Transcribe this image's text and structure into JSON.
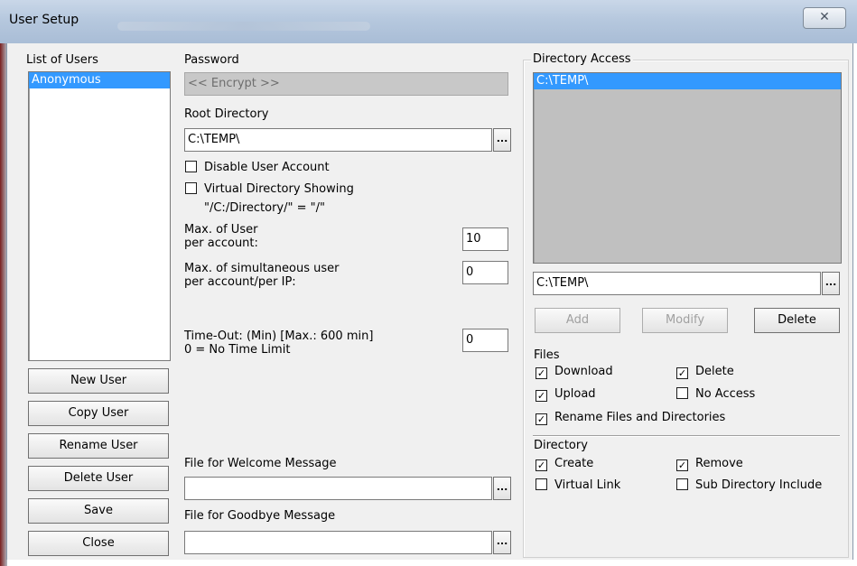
{
  "window": {
    "title": "User Setup",
    "close_glyph": "✕"
  },
  "users": {
    "label": "List of Users",
    "items": [
      "Anonymous"
    ],
    "buttons": [
      "New User",
      "Copy User",
      "Rename User",
      "Delete User",
      "Save",
      "Close"
    ]
  },
  "password": {
    "label": "Password",
    "value": "<< Encrypt >>"
  },
  "root_dir": {
    "label": "Root Directory",
    "value": "C:\\TEMP\\",
    "browse": "..."
  },
  "options": {
    "disable_account": {
      "label": "Disable User Account",
      "checked": false
    },
    "virtual_dir": {
      "label": "Virtual Directory Showing",
      "checked": false,
      "note": "\"/C:/Directory/\" = \"/\""
    }
  },
  "max_user": {
    "label1": "Max. of User",
    "label2": "per account:",
    "value": "10"
  },
  "max_sim": {
    "label1": "Max. of simultaneous user",
    "label2": "per account/per IP:",
    "value": "0"
  },
  "timeout": {
    "label1": "Time-Out: (Min) [Max.: 600 min]",
    "label2": "0 = No Time Limit",
    "value": "0"
  },
  "welcome": {
    "label": "File for Welcome Message",
    "value": "",
    "browse": "..."
  },
  "goodbye": {
    "label": "File for Goodbye Message",
    "value": "",
    "browse": "..."
  },
  "dir_access": {
    "label": "Directory Access",
    "items": [
      "C:\\TEMP\\"
    ],
    "path_value": "C:\\TEMP\\",
    "browse": "...",
    "add": "Add",
    "modify": "Modify",
    "delete": "Delete"
  },
  "files": {
    "label": "Files",
    "download": {
      "label": "Download",
      "checked": true
    },
    "delete": {
      "label": "Delete",
      "checked": true
    },
    "upload": {
      "label": "Upload",
      "checked": true
    },
    "no_access": {
      "label": "No Access",
      "checked": false
    },
    "rename": {
      "label": "Rename Files and Directories",
      "checked": true
    }
  },
  "directory": {
    "label": "Directory",
    "create": {
      "label": "Create",
      "checked": true
    },
    "remove": {
      "label": "Remove",
      "checked": true
    },
    "virtual_link": {
      "label": "Virtual Link",
      "checked": false
    },
    "sub_include": {
      "label": "Sub Directory Include",
      "checked": false
    }
  },
  "check_glyph": "✓"
}
